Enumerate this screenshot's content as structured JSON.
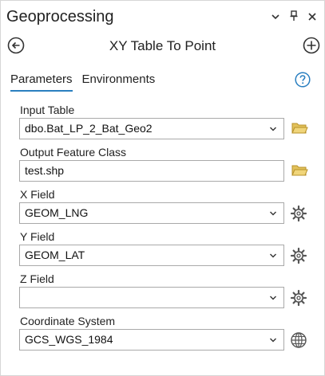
{
  "pane": {
    "title": "Geoprocessing",
    "controls": [
      "chevron-down-icon",
      "pin-icon",
      "close-icon"
    ]
  },
  "tool": {
    "title": "XY Table To Point"
  },
  "tabs": [
    {
      "label": "Parameters",
      "active": true
    },
    {
      "label": "Environments",
      "active": false
    }
  ],
  "parameters": {
    "input_table": {
      "label": "Input Table",
      "value": "dbo.Bat_LP_2_Bat_Geo2"
    },
    "output_feature_class": {
      "label": "Output Feature Class",
      "value": "test.shp"
    },
    "x_field": {
      "label": "X Field",
      "value": "GEOM_LNG"
    },
    "y_field": {
      "label": "Y Field",
      "value": "GEOM_LAT"
    },
    "z_field": {
      "label": "Z Field",
      "value": ""
    },
    "coordinate_system": {
      "label": "Coordinate System",
      "value": "GCS_WGS_1984"
    }
  },
  "colors": {
    "folder": "#d9b43c",
    "accent": "#2a7fc0",
    "border": "#a9a9a9"
  }
}
